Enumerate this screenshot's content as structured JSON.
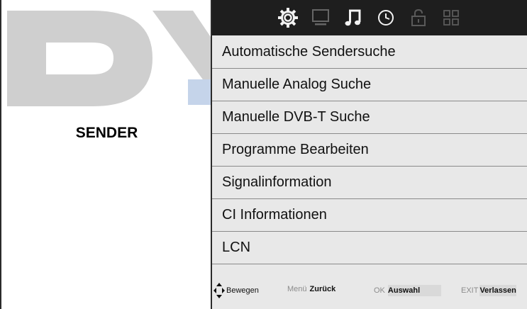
{
  "logo": {
    "text": "DY",
    "colors": {
      "primary": "#cfcfcf",
      "accent": "#c5d4ea"
    }
  },
  "section": {
    "title": "SENDER"
  },
  "topbar": {
    "tabs": [
      {
        "icon": "gear-icon",
        "active": true
      },
      {
        "icon": "monitor-icon",
        "active": false
      },
      {
        "icon": "music-note-icon",
        "active": false
      },
      {
        "icon": "clock-icon",
        "active": false
      },
      {
        "icon": "lock-icon",
        "active": false
      },
      {
        "icon": "grid-icon",
        "active": false
      }
    ]
  },
  "menu": {
    "items": [
      {
        "label": "Automatische Sendersuche"
      },
      {
        "label": "Manuelle Analog Suche"
      },
      {
        "label": "Manuelle DVB-T Suche"
      },
      {
        "label": "Programme Bearbeiten"
      },
      {
        "label": "Signalinformation"
      },
      {
        "label": "CI Informationen"
      },
      {
        "label": "LCN"
      }
    ]
  },
  "footer": {
    "move": {
      "label": "Bewegen"
    },
    "back": {
      "key": "Menü",
      "label": "Zurück"
    },
    "select": {
      "key": "OK",
      "label": "Auswahl"
    },
    "exit": {
      "key": "EXIT",
      "label": "Verlassen"
    }
  }
}
